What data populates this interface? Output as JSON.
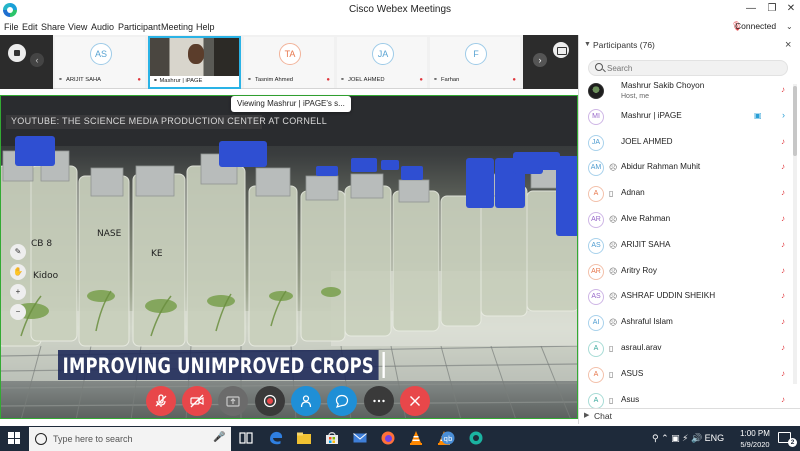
{
  "window": {
    "title": "Cisco Webex Meetings",
    "minimize_icon": "minimize-icon",
    "restore_icon": "restore-icon",
    "close_icon": "close-icon",
    "connection_status": "Connected"
  },
  "menu": [
    "File",
    "Edit",
    "Share",
    "View",
    "Audio",
    "Participant",
    "Meeting",
    "Help"
  ],
  "thumbnails": [
    {
      "initials": "",
      "name": "ARIJIT SAHA",
      "muted": true
    },
    {
      "initials": "",
      "name": "Mashrur | iPAGE",
      "muted": false,
      "video": true
    },
    {
      "initials": "TA",
      "name": "Tasnim Ahmed",
      "muted": true
    },
    {
      "initials": "JA",
      "name": "JOEL AHMED",
      "muted": true
    },
    {
      "initials": "F",
      "name": "Farhan",
      "muted": true
    }
  ],
  "thumb_avatar_initials": [
    "AS",
    "",
    "TA",
    "JA",
    "F"
  ],
  "stage": {
    "viewing_tooltip": "Viewing Mashrur | iPAGE's s...",
    "source_watermark": "YOUTUBE: THE SCIENCE MEDIA PRODUCTION CENTER AT CORNELL",
    "caption": "IMPROVING UNIMPROVED CROPS",
    "bottle_labels": [
      "CB 8",
      "Kidoo",
      "NASE",
      "KE"
    ]
  },
  "controls": [
    {
      "name": "mute-button",
      "icon": "microphone-off-icon",
      "color": "#e8474a"
    },
    {
      "name": "stop-video-button",
      "icon": "video-off-icon",
      "color": "#e8474a"
    },
    {
      "name": "share-button",
      "icon": "share-icon",
      "color": "#6b6b6b"
    },
    {
      "name": "record-button",
      "icon": "record-icon",
      "color": "#3a3a3a"
    },
    {
      "name": "participants-button",
      "icon": "person-icon",
      "color": "#1f8fd6"
    },
    {
      "name": "chat-button",
      "icon": "chat-icon",
      "color": "#1f8fd6"
    },
    {
      "name": "more-button",
      "icon": "more-icon",
      "color": "#3a3a3a"
    },
    {
      "name": "leave-button",
      "icon": "close-icon",
      "color": "#e8474a"
    }
  ],
  "participants": {
    "header": "Participants (76)",
    "search_placeholder": "Search",
    "list": [
      {
        "initials": "",
        "avatar": "photo",
        "device": "",
        "name": "Mashrur Sakib Choyon",
        "sub": "Host, me",
        "muted": true
      },
      {
        "initials": "MI",
        "avatar": "purple",
        "device": "",
        "name": "Mashrur | iPAGE",
        "sub": "",
        "video": true,
        "expand": true
      },
      {
        "initials": "JA",
        "avatar": "blue",
        "device": "",
        "name": "JOEL AHMED",
        "sub": "",
        "muted": true
      },
      {
        "initials": "AM",
        "avatar": "blue",
        "device": "headset",
        "name": "Abidur Rahman Muhit",
        "sub": "",
        "muted": true
      },
      {
        "initials": "A",
        "avatar": "orange",
        "device": "phone",
        "name": "Adnan",
        "sub": "",
        "muted": true
      },
      {
        "initials": "AR",
        "avatar": "purple",
        "device": "headset",
        "name": "Alve Rahman",
        "sub": "",
        "muted": true
      },
      {
        "initials": "AS",
        "avatar": "blue",
        "device": "headset",
        "name": "ARIJIT SAHA",
        "sub": "",
        "muted": true
      },
      {
        "initials": "AR",
        "avatar": "orange",
        "device": "headset",
        "name": "Aritry Roy",
        "sub": "",
        "muted": true
      },
      {
        "initials": "AS",
        "avatar": "purple",
        "device": "headset",
        "name": "ASHRAF UDDIN SHEIKH",
        "sub": "",
        "muted": true
      },
      {
        "initials": "AI",
        "avatar": "blue",
        "device": "headset",
        "name": "Ashraful Islam",
        "sub": "",
        "muted": true
      },
      {
        "initials": "A",
        "avatar": "teal",
        "device": "phone",
        "name": "asraul.arav",
        "sub": "",
        "muted": true
      },
      {
        "initials": "A",
        "avatar": "orange",
        "device": "phone",
        "name": "ASUS",
        "sub": "",
        "muted": true
      },
      {
        "initials": "A",
        "avatar": "teal",
        "device": "phone",
        "name": "Asus",
        "sub": "",
        "muted": true
      }
    ],
    "chat_label": "Chat"
  },
  "taskbar": {
    "search_placeholder": "Type here to search",
    "time": "1:00 PM",
    "date": "5/9/2020",
    "notification_count": "2",
    "apps": [
      "task-view-icon",
      "edge-icon",
      "file-explorer-icon",
      "store-icon",
      "mail-icon",
      "firefox-icon",
      "vlc-icon",
      "vlc-icon",
      "qbittorrent-icon",
      "webex-icon"
    ]
  },
  "colors": {
    "accent": "#1f8fd6",
    "danger": "#e8474a",
    "taskbar": "#1e2a3a"
  }
}
